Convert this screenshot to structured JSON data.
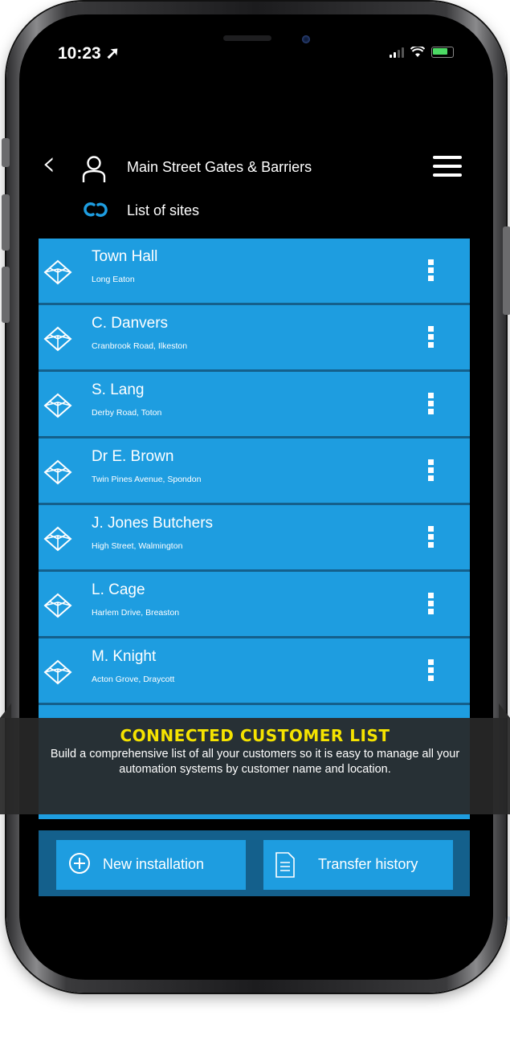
{
  "status": {
    "time": "10:23 ➚"
  },
  "header": {
    "back_icon": "chevron-left-icon",
    "user_icon": "user-icon",
    "title": "Main Street Gates & Barriers",
    "menu_icon": "hamburger-menu-icon",
    "link_icon": "link-icon",
    "subtitle": "List of sites"
  },
  "sites": [
    {
      "name": "Town Hall",
      "address": "Long Eaton"
    },
    {
      "name": "C. Danvers",
      "address": "Cranbrook Road, Ilkeston"
    },
    {
      "name": "S. Lang",
      "address": "Derby Road, Toton"
    },
    {
      "name": "Dr E. Brown",
      "address": "Twin Pines Avenue, Spondon"
    },
    {
      "name": "J. Jones Butchers",
      "address": "High Street, Walmington"
    },
    {
      "name": "L. Cage",
      "address": "Harlem Drive, Breaston"
    },
    {
      "name": "M. Knight",
      "address": "Acton Grove, Draycott"
    }
  ],
  "actions": {
    "new_installation": "New installation",
    "transfer_history": "Transfer history"
  },
  "banner": {
    "title": "CONNECTED CUSTOMER LIST",
    "text": "Build a comprehensive list of all your customers so it is easy to manage all your automation systems by customer name and location."
  },
  "colors": {
    "list_blue": "#1e9de0",
    "divider_blue": "#14608c",
    "banner_title": "#f5e300",
    "battery_green": "#4cd964"
  }
}
